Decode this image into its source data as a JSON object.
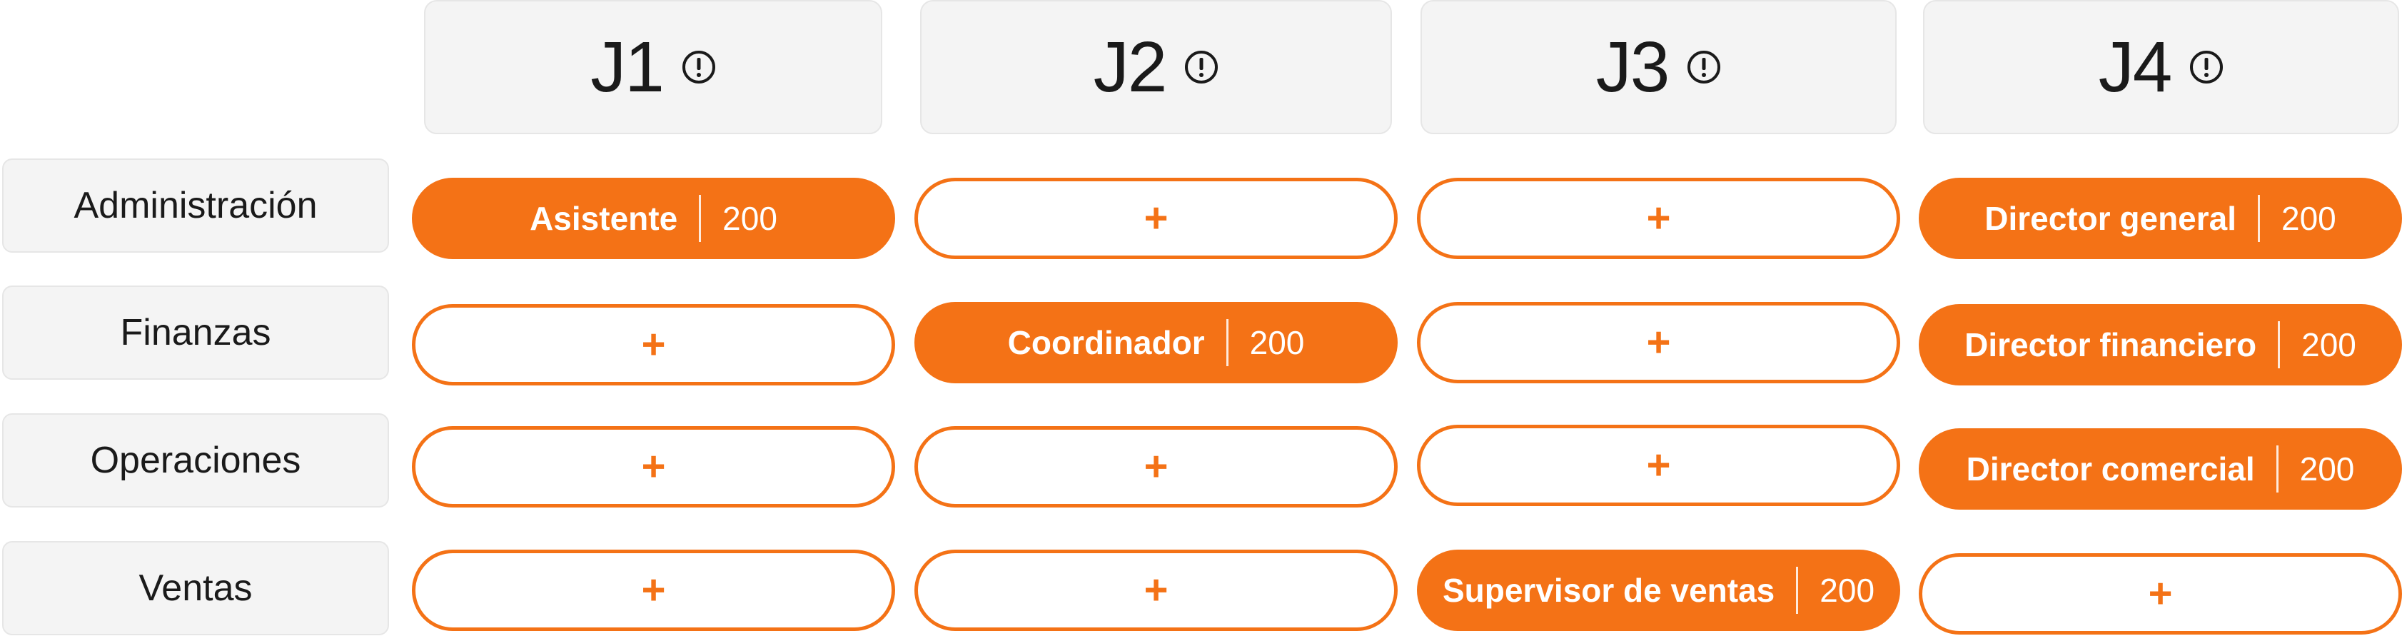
{
  "columns": [
    {
      "label": "J1",
      "icon": "info-icon"
    },
    {
      "label": "J2",
      "icon": "info-icon"
    },
    {
      "label": "J3",
      "icon": "info-icon"
    },
    {
      "label": "J4",
      "icon": "info-icon"
    }
  ],
  "rows": [
    {
      "label": "Administración"
    },
    {
      "label": "Finanzas"
    },
    {
      "label": "Operaciones"
    },
    {
      "label": "Ventas"
    }
  ],
  "cells": {
    "r0": [
      {
        "role": "Asistente",
        "value": "200"
      },
      {
        "add": "+"
      },
      {
        "add": "+"
      },
      {
        "role": "Director general",
        "value": "200"
      }
    ],
    "r1": [
      {
        "add": "+"
      },
      {
        "role": "Coordinador",
        "value": "200"
      },
      {
        "add": "+"
      },
      {
        "role": "Director financiero",
        "value": "200"
      }
    ],
    "r2": [
      {
        "add": "+"
      },
      {
        "add": "+"
      },
      {
        "add": "+"
      },
      {
        "role": "Director comercial",
        "value": "200"
      }
    ],
    "r3": [
      {
        "add": "+"
      },
      {
        "add": "+"
      },
      {
        "role": "Supervisor de ventas",
        "value": "200"
      },
      {
        "add": "+"
      }
    ]
  },
  "colors": {
    "accent": "#f47216",
    "header_bg": "#f4f4f4"
  }
}
